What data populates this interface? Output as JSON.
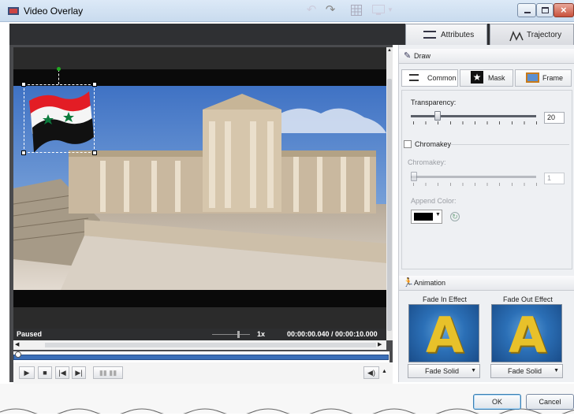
{
  "window": {
    "title": "Video Overlay"
  },
  "tabs": [
    {
      "label": "Attributes"
    },
    {
      "label": "Trajectory"
    }
  ],
  "draw_section": {
    "title": "Draw"
  },
  "subtabs": [
    {
      "label": "Common"
    },
    {
      "label": "Mask"
    },
    {
      "label": "Frame"
    }
  ],
  "transparency": {
    "label": "Transparency:",
    "value": "20"
  },
  "chromakey": {
    "checkbox_label": "Chromakey",
    "slider_label": "Chromakey:",
    "value": "1",
    "append_color_label": "Append Color:"
  },
  "animation": {
    "title": "Animation",
    "fade_in_label": "Fade In Effect",
    "fade_out_label": "Fade Out Effect",
    "fade_in_value": "Fade Solid",
    "fade_out_value": "Fade Solid",
    "effect_glyph": "A"
  },
  "player": {
    "status": "Paused",
    "speed": "1x",
    "time": "00:00:00.040 / 00:00:10.000"
  },
  "buttons": {
    "ok": "OK",
    "cancel": "Cancel"
  },
  "colors": {
    "toolbar_bg": "#2f3033",
    "selection_handle": "#22aa22",
    "append_color": "#000000"
  }
}
